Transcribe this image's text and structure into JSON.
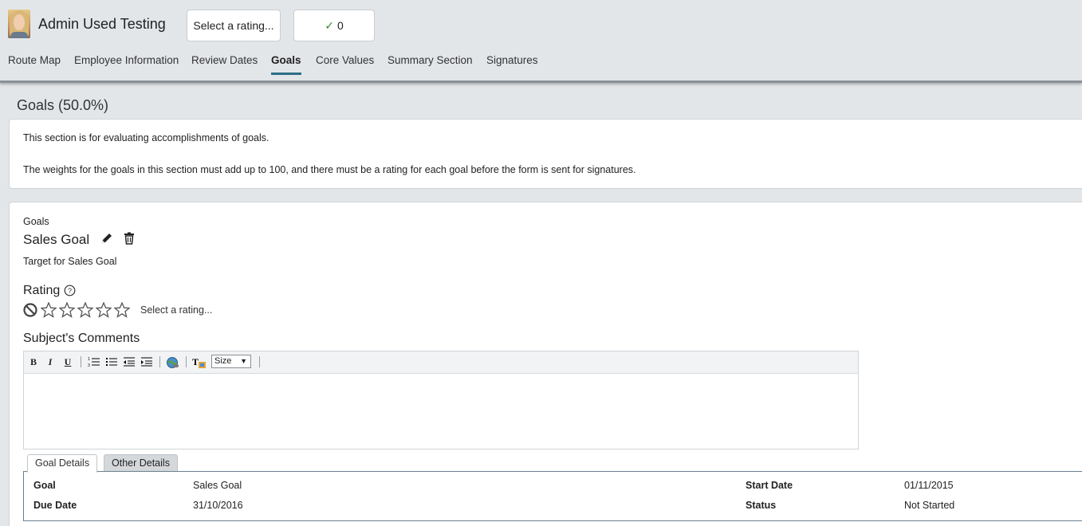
{
  "header": {
    "user_name": "Admin Used Testing",
    "rating_select": "Select a rating...",
    "check_count": "0",
    "check_icon": "check-icon",
    "nav": [
      {
        "label": "Route Map",
        "active": false
      },
      {
        "label": "Employee Information",
        "active": false
      },
      {
        "label": "Review Dates",
        "active": false
      },
      {
        "label": "Goals",
        "active": true
      },
      {
        "label": "Core Values",
        "active": false
      },
      {
        "label": "Summary Section",
        "active": false
      },
      {
        "label": "Signatures",
        "active": false
      }
    ],
    "accent_color": "#2e6e86"
  },
  "section": {
    "title": "Goals (50.0%)",
    "intro1": "This section is for evaluating accomplishments of goals.",
    "intro2": "The weights for the goals in this section must add up to 100, and there must be a rating for each goal before the form is sent for signatures."
  },
  "goal": {
    "group_label": "Goals",
    "name": "Sales Goal",
    "target": "Target for Sales Goal",
    "rating_label": "Rating",
    "rating_placeholder": "Select a rating...",
    "stars_total": 5,
    "stars_selected": 0,
    "comments_label": "Subject's Comments",
    "toolbar": {
      "bold": "B",
      "italic": "I",
      "underline": "U",
      "size": "Size"
    },
    "tabs": [
      {
        "label": "Goal Details",
        "active": true
      },
      {
        "label": "Other Details",
        "active": false
      }
    ],
    "details": {
      "goal_label": "Goal",
      "goal_value": "Sales Goal",
      "start_label": "Start Date",
      "start_value": "01/11/2015",
      "due_label": "Due Date",
      "due_value": "31/10/2016",
      "status_label": "Status",
      "status_value": "Not Started"
    }
  }
}
